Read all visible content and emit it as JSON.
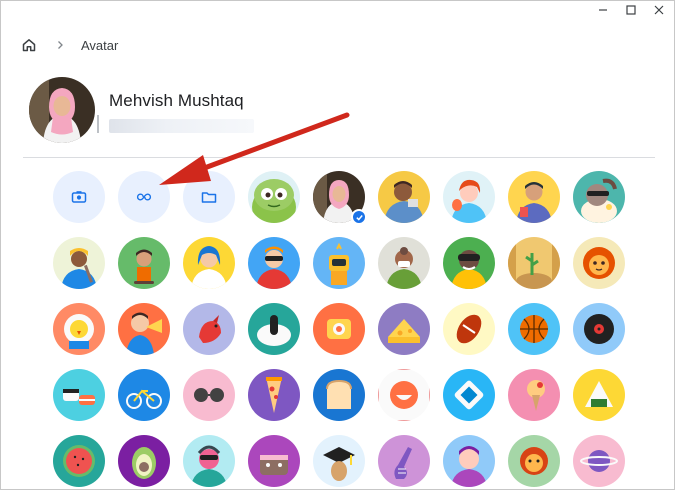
{
  "window": {
    "controls": {
      "minimize": "minimize-icon",
      "maximize": "maximize-icon",
      "close": "close-icon"
    }
  },
  "breadcrumb": {
    "home_icon": "home-icon",
    "separator_icon": "chevron-right-icon",
    "title": "Avatar"
  },
  "profile": {
    "name": "Mehvish Mushtaq"
  },
  "actions": [
    {
      "name": "take-photo-button",
      "icon": "camera-icon"
    },
    {
      "name": "link-button",
      "icon": "link-icon"
    },
    {
      "name": "choose-file-button",
      "icon": "folder-icon"
    }
  ],
  "avatars": {
    "selected_index": 1,
    "rows": [
      [
        "green-monster",
        "profile-photo",
        "mechanic",
        "redhead-woman",
        "man-with-glasses",
        "dog-sunglasses"
      ],
      [
        "cricket-player",
        "skater",
        "blue-hair-woman",
        "sunglasses-man",
        "robot-dog",
        "chef-with-mask",
        "vr-headset-man",
        "cactus-room",
        "lion-mask"
      ],
      [
        "yellow-bird",
        "trumpet-player",
        "red-bird",
        "penguin-bowl",
        "retro-camera",
        "cheese-wedge",
        "football",
        "basketball",
        "vinyl-record"
      ],
      [
        "sushi",
        "bicycle",
        "sunglasses",
        "pizza-slice",
        "bread-toast",
        "smiley-ring",
        "blue-diamond",
        "ice-cream",
        "onigiri"
      ],
      [
        "watermelon",
        "avocado",
        "pink-alien",
        "purple-cake",
        "graduation-cap",
        "purple-guitar",
        "cartoon-boy",
        "lion-face",
        "planet"
      ]
    ]
  },
  "colors": {
    "accent": "#1a73e8",
    "action_bg": "#e8f0fe",
    "arrow": "#d0281c"
  }
}
